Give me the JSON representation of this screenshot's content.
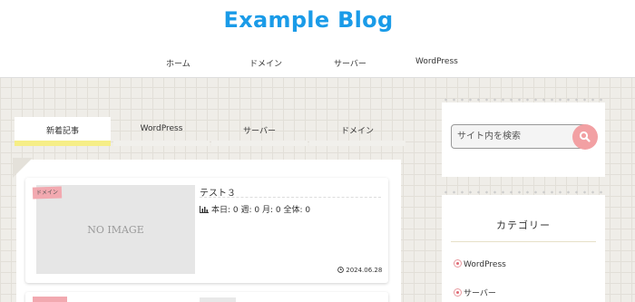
{
  "header": {
    "site_title": "Example Blog",
    "nav": [
      "ホーム",
      "ドメイン",
      "サーバー",
      "WordPress"
    ]
  },
  "tabs": [
    {
      "label": "新着記事",
      "active": true
    },
    {
      "label": "WordPress",
      "active": false
    },
    {
      "label": "サーバー",
      "active": false
    },
    {
      "label": "ドメイン",
      "active": false
    }
  ],
  "articles": [
    {
      "category": "ドメイン",
      "thumbnail_text": "NO IMAGE",
      "title": "テスト３",
      "views": "本日: 0  週: 0  月: 0  全体: 0",
      "date": "2024.06.28"
    }
  ],
  "sidebar": {
    "search_placeholder": "サイト内を検索",
    "category_heading": "カテゴリー",
    "categories": [
      "WordPress",
      "サーバー"
    ]
  },
  "colors": {
    "title_blue": "#1a9be8",
    "active_tab_underline": "#f6ee87",
    "accent_pink": "#f2a0a3"
  }
}
